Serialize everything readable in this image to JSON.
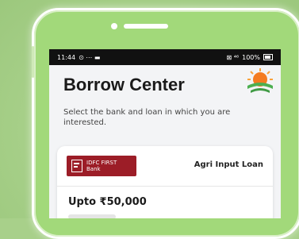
{
  "status_bar": {
    "time": "11:44",
    "left_icons": "⊙ ⋯ ▬",
    "signal": "⊠ ⁴⁶",
    "battery": "100%"
  },
  "page": {
    "title": "Borrow Center",
    "subtitle": "Select the bank and loan in which you are interested."
  },
  "loan_card": {
    "bank_name_line1": "IDFC FIRST",
    "bank_name_line2": "Bank",
    "loan_type": "Agri Input Loan",
    "amount": "Upto ₹50,000",
    "bank_color": "#9c1d27"
  },
  "colors": {
    "background": "#a8d08a",
    "phone_body": "#a2d97a",
    "sun_orange": "#f47b20",
    "sun_green": "#4caf50"
  }
}
